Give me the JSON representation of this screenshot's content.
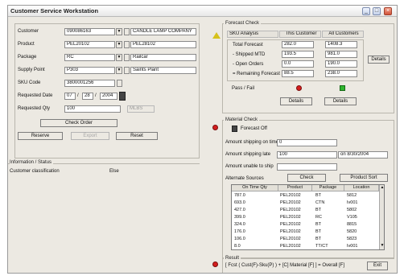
{
  "window": {
    "title": "Customer Service Workstation"
  },
  "titlebar_buttons": {
    "minimize": "_",
    "maximize": "□",
    "close": "×"
  },
  "order": {
    "customer_label": "Customer",
    "customer_value": "090086163",
    "customer_name": "CANDLE LAMP COMPANY",
    "product_label": "Product",
    "product_value": "PEL20102",
    "product_desc": "PEL28102",
    "package_label": "Package",
    "package_value": "RC",
    "package_desc": "Railcar",
    "supply_label": "Supply Point",
    "supply_value": "P303",
    "supply_desc": "Saints Plant",
    "sku_label": "SKU Code",
    "sku_value": "3800001256",
    "reqdate_label": "Requested Date",
    "req_month": "07",
    "req_day": "28",
    "req_year": "2004",
    "reqqty_label": "Requested Qty",
    "reqqty_value": "100",
    "reqqty_unit": "MLBS",
    "check_order": "Check Order",
    "reserve": "Reserve",
    "export": "Export",
    "reset": "Reset"
  },
  "info": {
    "title": "Information / Status",
    "class_label": "Customer classification",
    "class_value": "Else"
  },
  "forecast": {
    "title": "Forecast Check",
    "col_sku": "SKU Analysis",
    "col_this": "This Customer",
    "col_all": "All Customers",
    "rows": [
      {
        "label": "Total Forecast",
        "this": "282.0",
        "all": "1408.3"
      },
      {
        "label": "- Shipped MTD",
        "this": "193.5",
        "all": "981.0"
      },
      {
        "label": "- Open Orders",
        "this": "0.0",
        "all": "190.0"
      },
      {
        "label": "= Remaining Forecast",
        "this": "88.5",
        "all": "238.0"
      }
    ],
    "pass_fail": "Pass / Fail",
    "details": "Details",
    "details_this": "Details",
    "details_all": "Details"
  },
  "material": {
    "title": "Material Check",
    "forecast_off": "Forecast Off",
    "on_time_label": "Amount shipping on time",
    "on_time_value": "0",
    "late_label": "Amount shipping late",
    "late_value": "100",
    "late_date": "on 8/30/2004",
    "unable_label": "Amount unable to ship",
    "alt_label": "Alternate Sources",
    "check": "Check",
    "product_sort": "Product Sort",
    "columns": [
      "On Time Qty",
      "Product",
      "Package",
      "Location"
    ],
    "rows": [
      [
        "787.0",
        "PEL20102",
        "BT",
        "5812"
      ],
      [
        "693.0",
        "PEL20102",
        "CTN",
        "Iv001"
      ],
      [
        "427.0",
        "PEL20102",
        "BT",
        "5802"
      ],
      [
        "399.0",
        "PEL20102",
        "RC",
        "V105"
      ],
      [
        "324.0",
        "PEL20102",
        "BT",
        "8815"
      ],
      [
        "176.0",
        "PEL20102",
        "BT",
        "5820"
      ],
      [
        "106.0",
        "PEL20102",
        "BT",
        "5823"
      ],
      [
        "8.0",
        "PEL20102",
        "TT/CT",
        "Iv001"
      ]
    ]
  },
  "result": {
    "title": "Result",
    "formula": "[ Fcst ( Cust(F)-Sku(P) ) + [C] Material [F] ] = Overall [F]",
    "exit": "Exit"
  },
  "colors": {
    "window_bg": "#ece9e2",
    "pass": "#2fb52f",
    "fail": "#d41e1e",
    "warn": "#d6c11b"
  }
}
